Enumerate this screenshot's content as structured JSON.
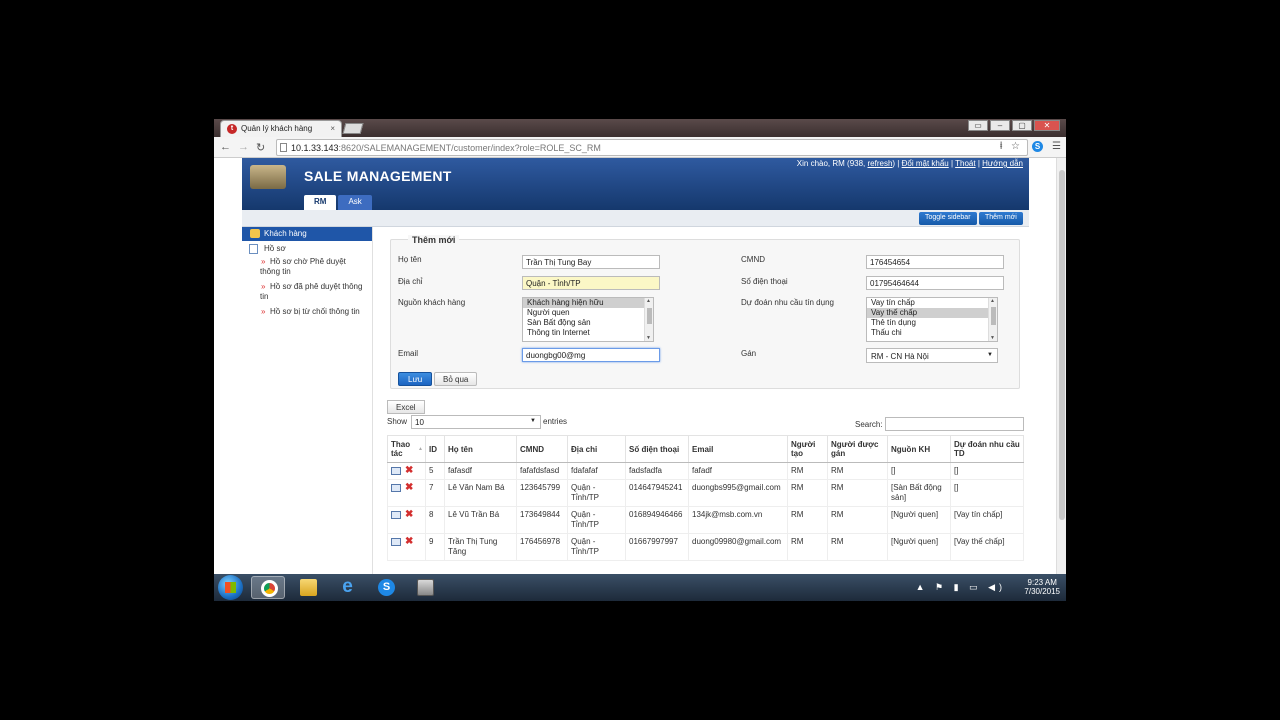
{
  "browser": {
    "tab_title": "Quản lý khách hàng",
    "tab_close": "×",
    "url_host": "10.1.33.143",
    "url_rest": ":8620/SALEMANAGEMENT/customer/index?role=ROLE_SC_RM",
    "window_buttons": [
      "▭",
      "–",
      "▢",
      "✕"
    ]
  },
  "app": {
    "title": "SALE MANAGEMENT",
    "greeting": "Xin chào, RM (938, ",
    "refresh": "refresh",
    "greeting_end": ") |",
    "change_password": "Đổi mật khẩu",
    "logout": "Thoát",
    "help": "Hướng dẫn",
    "tabs": [
      "RM",
      "Ask"
    ],
    "toggle_sidebar": "Toggle sidebar",
    "add_new": "Thêm mới"
  },
  "sidebar": {
    "header": "Khách hàng",
    "item": "Hồ sơ",
    "sub": [
      "Hồ sơ chờ Phê duyệt thông tin",
      "Hồ sơ đã phê duyệt thông tin",
      "Hồ sơ bị từ chối thông tin"
    ]
  },
  "form": {
    "legend": "Thêm mới",
    "name_label": "Họ tên",
    "name_value": "Trần Thị Tung Bay",
    "cmnd_label": "CMND",
    "cmnd_value": "176454654",
    "address_label": "Địa chỉ",
    "address_value": "Quận - Tỉnh/TP",
    "phone_label": "Số điện thoại",
    "phone_value": "01795464644",
    "source_label": "Nguồn khách hàng",
    "source_options": [
      "Khách hàng hiện hữu",
      "Người quen",
      "Sàn Bất động sản",
      "Thông tin Internet"
    ],
    "credit_label": "Dự đoán nhu cầu tín dụng",
    "credit_options": [
      "Vay tín chấp",
      "Vay thế chấp",
      "Thẻ tín dụng",
      "Thấu chi"
    ],
    "email_label": "Email",
    "email_value": "duongbg00@mg",
    "assign_label": "Gán",
    "assign_value": "RM - CN Hà Nội",
    "save": "Lưu",
    "skip": "Bỏ qua"
  },
  "table": {
    "excel": "Excel",
    "show": "Show",
    "length": "10",
    "entries": "entries",
    "search": "Search:",
    "headers": [
      "Thao tác",
      "ID",
      "Họ tên",
      "CMND",
      "Địa chỉ",
      "Số điện thoại",
      "Email",
      "Người tạo",
      "Người được gán",
      "Nguồn KH",
      "Dự đoán nhu cầu TD"
    ],
    "rows": [
      [
        "5",
        "fafasdf",
        "fafafdsfasd",
        "fdafafaf",
        "fadsfadfa",
        "fafadf",
        "RM",
        "RM",
        "[]",
        "[]"
      ],
      [
        "7",
        "Lê Văn Nam Bá",
        "123645799",
        "Quận - Tỉnh/TP",
        "014647945241",
        "duongbs995@gmail.com",
        "RM",
        "RM",
        "[Sàn Bất động sản]",
        "[]"
      ],
      [
        "8",
        "Lê Vũ Trần Bá",
        "173649844",
        "Quận - Tỉnh/TP",
        "016894946466",
        "134jk@msb.com.vn",
        "RM",
        "RM",
        "[Người quen]",
        "[Vay tín chấp]"
      ],
      [
        "9",
        "Trần Thị Tung Tăng",
        "176456978",
        "Quận - Tỉnh/TP",
        "01667997997",
        "duong09980@gmail.com",
        "RM",
        "RM",
        "[Người quen]",
        "[Vay thế chấp]"
      ]
    ]
  },
  "taskbar": {
    "time": "9:23 AM",
    "date": "7/30/2015"
  }
}
